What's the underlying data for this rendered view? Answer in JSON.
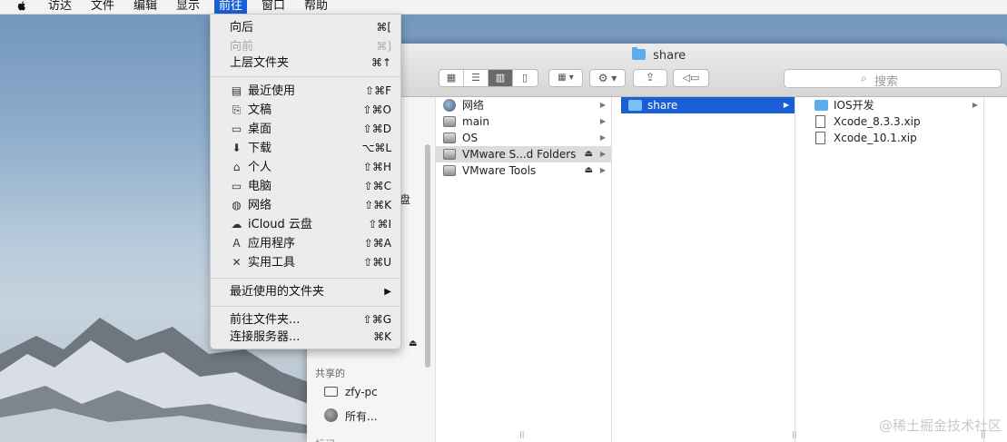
{
  "menubar": {
    "items": [
      "访达",
      "文件",
      "编辑",
      "显示",
      "前往",
      "窗口",
      "帮助"
    ],
    "active": "前往"
  },
  "go_menu": {
    "items": [
      {
        "label": "向后",
        "shortcut": "⌘[",
        "disabled": false
      },
      {
        "label": "向前",
        "shortcut": "⌘]",
        "disabled": true
      },
      {
        "label": "上层文件夹",
        "shortcut": "⌘↑",
        "disabled": false
      },
      {
        "label": "最近使用",
        "shortcut": "⇧⌘F",
        "icon": "recents-icon"
      },
      {
        "label": "文稿",
        "shortcut": "⇧⌘O",
        "icon": "documents-icon"
      },
      {
        "label": "桌面",
        "shortcut": "⇧⌘D",
        "icon": "desktop-icon"
      },
      {
        "label": "下载",
        "shortcut": "⌥⌘L",
        "icon": "downloads-icon"
      },
      {
        "label": "个人",
        "shortcut": "⇧⌘H",
        "icon": "home-icon"
      },
      {
        "label": "电脑",
        "shortcut": "⇧⌘C",
        "icon": "computer-icon"
      },
      {
        "label": "网络",
        "shortcut": "⇧⌘K",
        "icon": "network-icon"
      },
      {
        "label": "iCloud 云盘",
        "shortcut": "⇧⌘I",
        "icon": "icloud-icon"
      },
      {
        "label": "应用程序",
        "shortcut": "⇧⌘A",
        "icon": "applications-icon"
      },
      {
        "label": "实用工具",
        "shortcut": "⇧⌘U",
        "icon": "utilities-icon"
      },
      {
        "label": "最近使用的文件夹",
        "shortcut": "▶"
      },
      {
        "label": "前往文件夹...",
        "shortcut": "⇧⌘G"
      },
      {
        "label": "连接服务器...",
        "shortcut": "⌘K"
      }
    ]
  },
  "finder": {
    "title": "share",
    "search_placeholder": "搜索",
    "sidebar": {
      "partial_label": "盘",
      "section_shared": "共享的",
      "shared_items": [
        "zfy-pc",
        "所有..."
      ],
      "partial_bottom": "标记"
    },
    "columns": [
      {
        "items": [
          {
            "label": "网络",
            "icon": "network-icon"
          },
          {
            "label": "main",
            "icon": "disk-icon"
          },
          {
            "label": "OS",
            "icon": "disk-icon"
          },
          {
            "label": "VMware S...d Folders",
            "icon": "disk-icon",
            "eject": true,
            "selected_parent": true
          },
          {
            "label": "VMware Tools",
            "icon": "disk-icon",
            "eject": true
          }
        ]
      },
      {
        "items": [
          {
            "label": "share",
            "icon": "folder-icon",
            "selected": true
          }
        ]
      },
      {
        "items": [
          {
            "label": "IOS开发",
            "icon": "folder-icon",
            "has_children": true
          },
          {
            "label": "Xcode_8.3.3.xip",
            "icon": "file-icon"
          },
          {
            "label": "Xcode_10.1.xip",
            "icon": "file-icon"
          }
        ]
      }
    ]
  },
  "watermark": "@稀土掘金技术社区"
}
